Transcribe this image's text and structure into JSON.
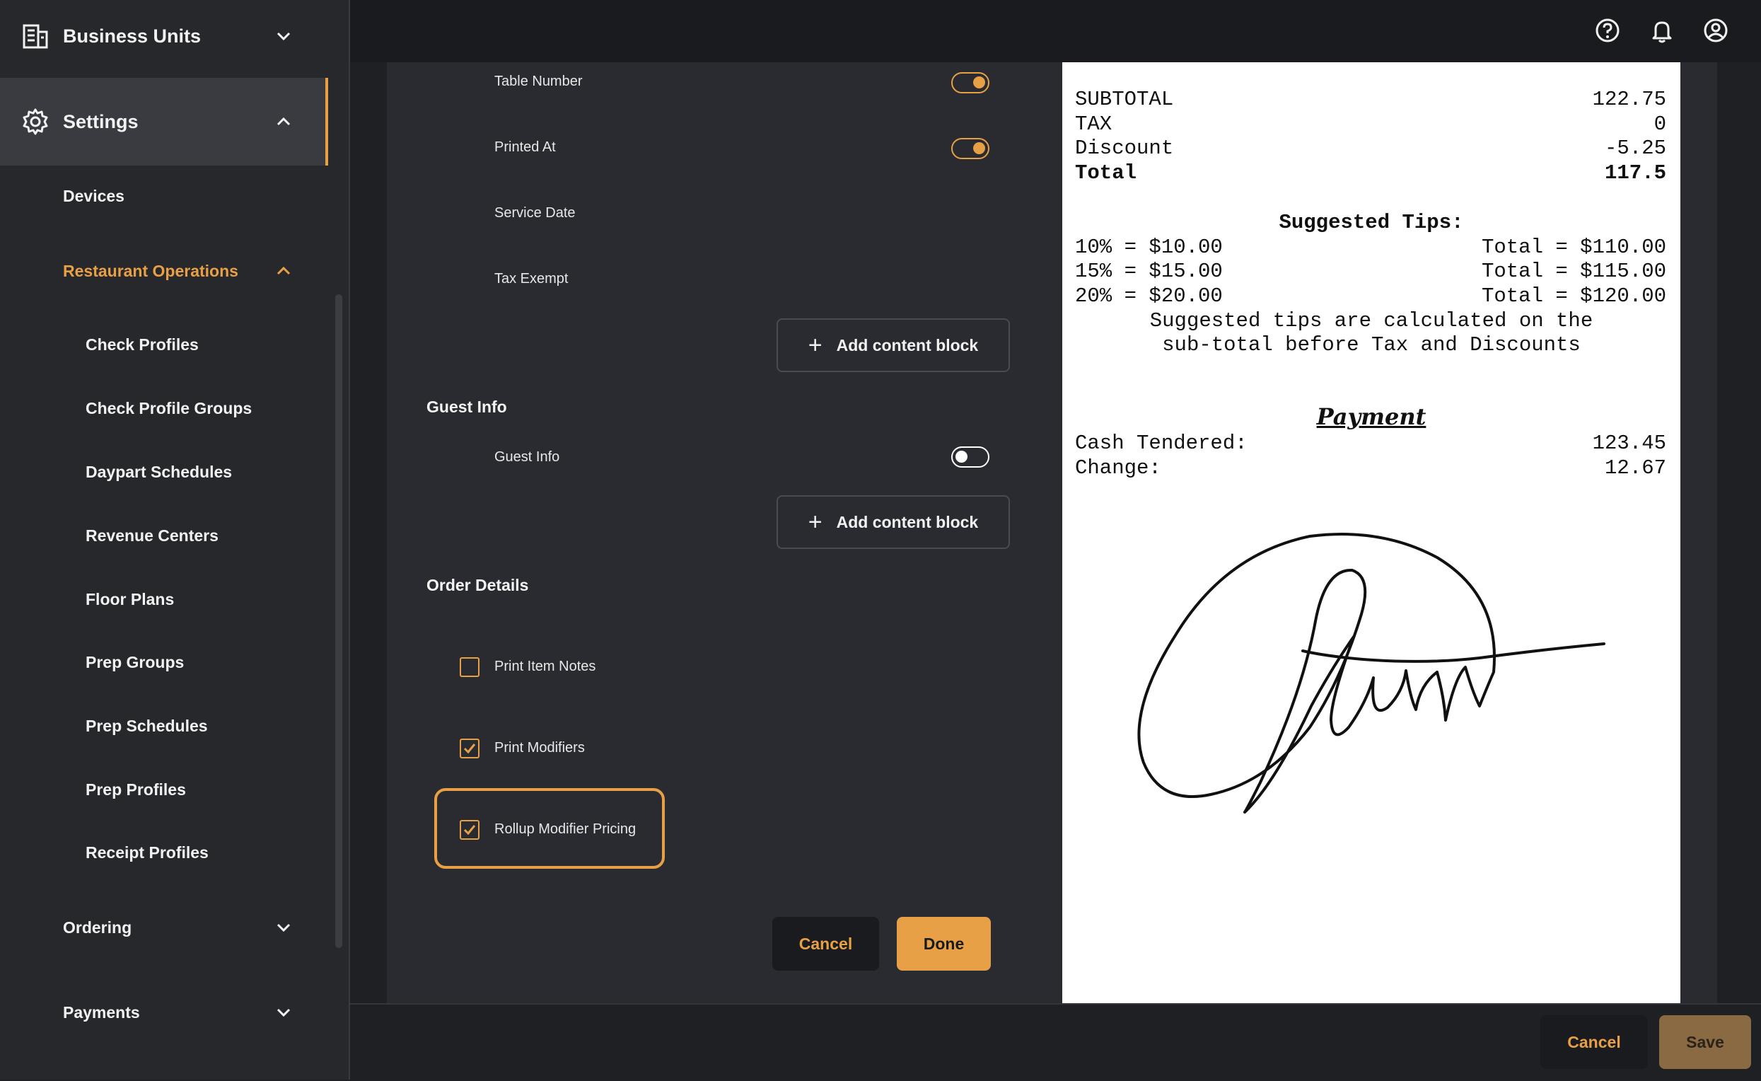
{
  "sidebar": {
    "business_units": "Business Units",
    "settings": "Settings",
    "devices": "Devices",
    "restaurant_operations": "Restaurant Operations",
    "items": [
      "Check Profiles",
      "Check Profile Groups",
      "Daypart Schedules",
      "Revenue Centers",
      "Floor Plans",
      "Prep Groups",
      "Prep Schedules",
      "Prep Profiles",
      "Receipt Profiles"
    ],
    "ordering": "Ordering",
    "payments": "Payments"
  },
  "editor": {
    "fields": [
      {
        "label": "Table Number",
        "toggle": "on"
      },
      {
        "label": "Printed At",
        "toggle": "on"
      },
      {
        "label": "Service Date"
      },
      {
        "label": "Tax Exempt"
      }
    ],
    "add_block_label": "Add content block",
    "guest_info_section": "Guest Info",
    "guest_info_label": "Guest Info",
    "guest_info_toggle": "off",
    "order_details_section": "Order Details",
    "checkboxes": [
      {
        "label": "Print Item Notes",
        "checked": false
      },
      {
        "label": "Print Modifiers",
        "checked": true
      },
      {
        "label": "Rollup Modifier Pricing",
        "checked": true
      }
    ],
    "cancel_label": "Cancel",
    "done_label": "Done"
  },
  "receipt": {
    "subtotal_label": "SUBTOTAL",
    "subtotal": "122.75",
    "tax_label": "TAX",
    "tax": "0",
    "discount_label": "Discount",
    "discount": "-5.25",
    "total_label": "Total",
    "total": "117.5",
    "tips_title": "Suggested Tips:",
    "tips": [
      {
        "left": "10% = $10.00",
        "right": "Total = $110.00"
      },
      {
        "left": "15% = $15.00",
        "right": "Total = $115.00"
      },
      {
        "left": "20% = $20.00",
        "right": "Total = $120.00"
      }
    ],
    "tips_note_1": "Suggested tips are calculated on the",
    "tips_note_2": "sub-total before Tax and Discounts",
    "payment_title": "Payment",
    "cash_label": "Cash Tendered:",
    "cash": "123.45",
    "change_label": "Change:",
    "change": "12.67"
  },
  "footer": {
    "cancel_label": "Cancel",
    "save_label": "Save"
  },
  "colors": {
    "accent": "#e8a046",
    "sidebar_bg": "#27282c",
    "panel_bg": "#2a2b30"
  }
}
